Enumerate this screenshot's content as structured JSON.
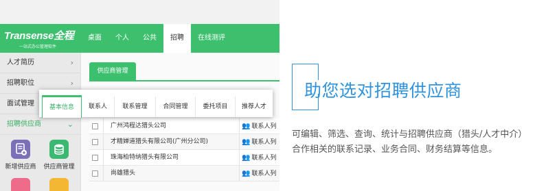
{
  "app": {
    "logo": "Transense全程",
    "logo_tagline": "一站式办公管理软件"
  },
  "nav": [
    {
      "label": "桌面"
    },
    {
      "label": "个人"
    },
    {
      "label": "公共"
    },
    {
      "label": "招聘",
      "active": true
    },
    {
      "label": "在线测评"
    }
  ],
  "sidebar": {
    "items": [
      {
        "label": "人才简历",
        "arrow": "›"
      },
      {
        "label": "招聘职位",
        "arrow": "›"
      },
      {
        "label": "面试管理",
        "arrow": "›"
      },
      {
        "label": "招聘供应商",
        "arrow": "⌄",
        "active": true
      }
    ],
    "tiles": [
      {
        "label": "新增供应商",
        "icon": "add-supplier-icon",
        "color": "#7b6fb8"
      },
      {
        "label": "供应商管理",
        "icon": "database-icon",
        "color": "#3cb873"
      },
      {
        "label": "",
        "icon": "pink-tile-icon",
        "color": "#ef6b8a"
      },
      {
        "label": "",
        "icon": "yellow-tile-icon",
        "color": "#f3b734"
      }
    ]
  },
  "content": {
    "subtab": "供应商管理"
  },
  "popup_tabs": [
    {
      "label": "基本信息",
      "active": true
    },
    {
      "label": "联系人"
    },
    {
      "label": "联系管理"
    },
    {
      "label": "合同管理"
    },
    {
      "label": "委托项目"
    },
    {
      "label": "推荐人才"
    }
  ],
  "table": {
    "rows": [
      {
        "name": "广州鸿程达猎头公司",
        "contact": "联系人列"
      },
      {
        "name": "才精婵道猎头有限公司(广州分公司)",
        "contact": "联系人列"
      },
      {
        "name": "珠海柏特纳猎头有限公司",
        "contact": "联系人列"
      },
      {
        "name": "尚雄猎头",
        "contact": "联系人列"
      }
    ]
  },
  "promo": {
    "headline": "助您选对招聘供应商",
    "desc_line1": "可编辑、筛选、查询、统计与招聘供应商（猎头/人才中介）",
    "desc_line2": "合作相关的联系记录、业务合同、财务结算等信息。"
  },
  "colors": {
    "brand_green": "#3cc06e",
    "accent_blue": "#2f93de"
  }
}
